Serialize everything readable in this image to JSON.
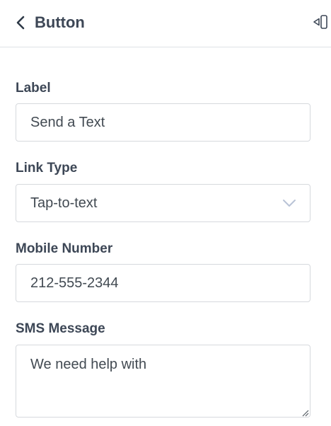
{
  "header": {
    "title": "Button",
    "back_icon": "chevron-left-icon",
    "collapse_icon": "collapse-panel-icon"
  },
  "fields": {
    "label": {
      "label": "Label",
      "value": "Send a Text"
    },
    "link_type": {
      "label": "Link Type",
      "value": "Tap-to-text",
      "icon": "chevron-down-icon"
    },
    "mobile_number": {
      "label": "Mobile Number",
      "value": "212-555-2344"
    },
    "sms_message": {
      "label": "SMS Message",
      "value": "We need help with"
    }
  },
  "colors": {
    "text": "#3d4756",
    "border": "#d6d9dd",
    "chevron": "#b9c3d6"
  }
}
